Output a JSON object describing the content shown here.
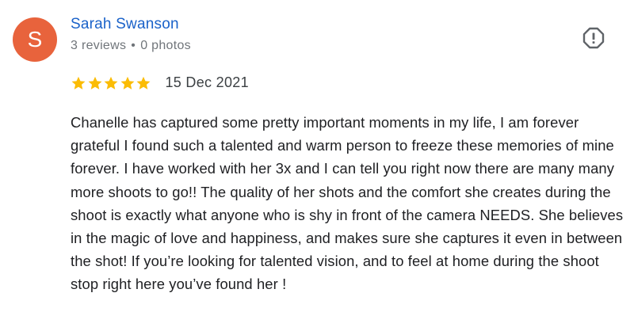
{
  "review": {
    "author": {
      "initial": "S",
      "name": "Sarah Swanson",
      "reviews": "3 reviews",
      "separator": "•",
      "photos": "0 photos",
      "avatar_color": "#e8633c"
    },
    "rating": 5,
    "star_color": "#fbbc04",
    "date": "15 Dec 2021",
    "text": "Chanelle has captured some pretty important moments in my life, I am forever grateful I found such a talented and warm person to freeze these memories of mine forever. I have worked with her 3x and I can tell you right now there are many many more shoots to go!! The quality of her shots and the comfort she creates during the shoot is exactly what anyone who is shy in front of the camera NEEDS. She believes in the magic of love and happiness, and makes sure she captures it even in between the shot! If you’re looking for talented vision, and to feel at home during the shoot stop right here you’ve found her !",
    "report_icon": "report-icon"
  }
}
